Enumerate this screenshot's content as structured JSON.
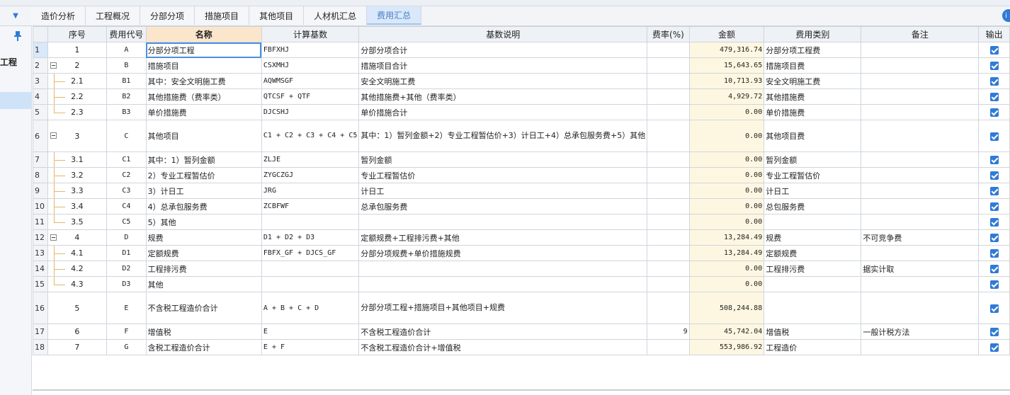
{
  "tabs": [
    "造价分析",
    "工程概况",
    "分部分项",
    "措施项目",
    "其他项目",
    "人材机汇总",
    "费用汇总"
  ],
  "active_tab": 6,
  "left_panel": {
    "project_label": "工程"
  },
  "headers": {
    "seq": "序号",
    "code": "费用代号",
    "name": "名称",
    "base": "计算基数",
    "desc": "基数说明",
    "rate": "费率(%)",
    "amount": "金额",
    "category": "费用类别",
    "remark": "备注",
    "output": "输出"
  },
  "rows": [
    {
      "rn": "1",
      "seq": "1",
      "code": "A",
      "name": "分部分项工程",
      "base": "FBFXHJ",
      "desc": "分部分项合计",
      "rate": "",
      "amount": "479,316.74",
      "category": "分部分项工程费",
      "remark": "",
      "output": true
    },
    {
      "rn": "2",
      "seq": "2",
      "code": "B",
      "name": "措施项目",
      "base": "CSXMHJ",
      "desc": "措施项目合计",
      "rate": "",
      "amount": "15,643.65",
      "category": "措施项目费",
      "remark": "",
      "output": true
    },
    {
      "rn": "3",
      "seq": "2.1",
      "code": "B1",
      "name": "其中：安全文明施工费",
      "base": "AQWMSGF",
      "desc": "安全文明施工费",
      "rate": "",
      "amount": "10,713.93",
      "category": "安全文明施工费",
      "remark": "",
      "output": true
    },
    {
      "rn": "4",
      "seq": "2.2",
      "code": "B2",
      "name": "其他措施费（费率类）",
      "base": "QTCSF + QTF",
      "desc": "其他措施费+其他（费率类）",
      "rate": "",
      "amount": "4,929.72",
      "category": "其他措施费",
      "remark": "",
      "output": true
    },
    {
      "rn": "5",
      "seq": "2.3",
      "code": "B3",
      "name": "单价措施费",
      "base": "DJCSHJ",
      "desc": "单价措施合计",
      "rate": "",
      "amount": "0.00",
      "category": "单价措施费",
      "remark": "",
      "output": true
    },
    {
      "rn": "6",
      "seq": "3",
      "code": "C",
      "name": "其他项目",
      "base": "C1 + C2 + C3 + C4 + C5",
      "desc": "其中：1）暂列金额+2）专业工程暂估价+3）计日工+4）总承包服务费+5）其他",
      "rate": "",
      "amount": "0.00",
      "category": "其他项目费",
      "remark": "",
      "output": true
    },
    {
      "rn": "7",
      "seq": "3.1",
      "code": "C1",
      "name": "其中：1）暂列金额",
      "base": "ZLJE",
      "desc": "暂列金额",
      "rate": "",
      "amount": "0.00",
      "category": "暂列金额",
      "remark": "",
      "output": true
    },
    {
      "rn": "8",
      "seq": "3.2",
      "code": "C2",
      "name": "2）专业工程暂估价",
      "base": "ZYGCZGJ",
      "desc": "专业工程暂估价",
      "rate": "",
      "amount": "0.00",
      "category": "专业工程暂估价",
      "remark": "",
      "output": true
    },
    {
      "rn": "9",
      "seq": "3.3",
      "code": "C3",
      "name": "3）计日工",
      "base": "JRG",
      "desc": "计日工",
      "rate": "",
      "amount": "0.00",
      "category": "计日工",
      "remark": "",
      "output": true
    },
    {
      "rn": "10",
      "seq": "3.4",
      "code": "C4",
      "name": "4）总承包服务费",
      "base": "ZCBFWF",
      "desc": "总承包服务费",
      "rate": "",
      "amount": "0.00",
      "category": "总包服务费",
      "remark": "",
      "output": true
    },
    {
      "rn": "11",
      "seq": "3.5",
      "code": "C5",
      "name": "5）其他",
      "base": "",
      "desc": "",
      "rate": "",
      "amount": "0.00",
      "category": "",
      "remark": "",
      "output": true
    },
    {
      "rn": "12",
      "seq": "4",
      "code": "D",
      "name": "规费",
      "base": "D1 + D2 + D3",
      "desc": "定额规费+工程排污费+其他",
      "rate": "",
      "amount": "13,284.49",
      "category": "规费",
      "remark": "不可竞争费",
      "output": true
    },
    {
      "rn": "13",
      "seq": "4.1",
      "code": "D1",
      "name": "定额规费",
      "base": "FBFX_GF + DJCS_GF",
      "desc": "分部分项规费+单价措施规费",
      "rate": "",
      "amount": "13,284.49",
      "category": "定额规费",
      "remark": "",
      "output": true
    },
    {
      "rn": "14",
      "seq": "4.2",
      "code": "D2",
      "name": "工程排污费",
      "base": "",
      "desc": "",
      "rate": "",
      "amount": "0.00",
      "category": "工程排污费",
      "remark": "据实计取",
      "output": true
    },
    {
      "rn": "15",
      "seq": "4.3",
      "code": "D3",
      "name": "其他",
      "base": "",
      "desc": "",
      "rate": "",
      "amount": "0.00",
      "category": "",
      "remark": "",
      "output": true
    },
    {
      "rn": "16",
      "seq": "5",
      "code": "E",
      "name": "不含税工程造价合计",
      "base": "A + B + C + D",
      "desc": "分部分项工程+措施项目+其他项目+规费",
      "rate": "",
      "amount": "508,244.88",
      "category": "",
      "remark": "",
      "output": true
    },
    {
      "rn": "17",
      "seq": "6",
      "code": "F",
      "name": "增值税",
      "base": "E",
      "desc": "不含税工程造价合计",
      "rate": "9",
      "amount": "45,742.04",
      "category": "增值税",
      "remark": "一般计税方法",
      "output": true
    },
    {
      "rn": "18",
      "seq": "7",
      "code": "G",
      "name": "含税工程造价合计",
      "base": "E + F",
      "desc": "不含税工程造价合计+增值税",
      "rate": "",
      "amount": "553,986.92",
      "category": "工程造价",
      "remark": "",
      "output": true
    }
  ],
  "colors": {
    "accent": "#2f7bd6",
    "amount_bg": "#fdf7e2",
    "header_highlight": "#fbe6cc",
    "active_tab_bg": "#d9e8fa"
  }
}
